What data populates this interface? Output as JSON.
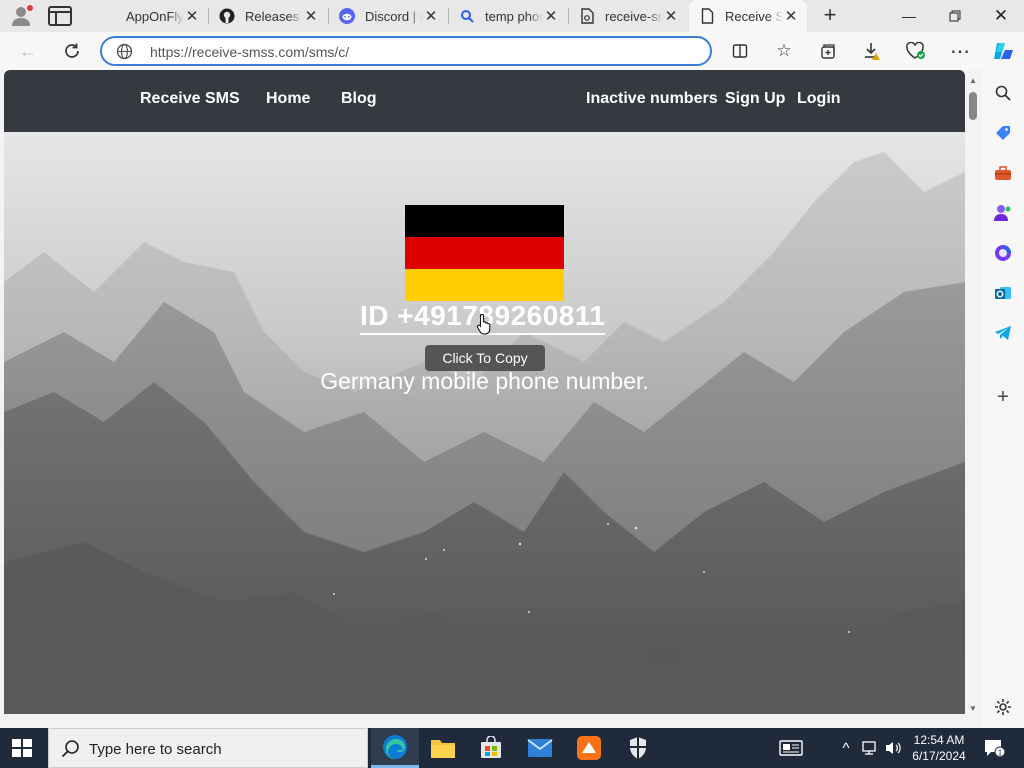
{
  "browser": {
    "tabs": [
      {
        "title": "AppOnFly",
        "favicon": "apponfly-icon"
      },
      {
        "title": "Releases ·",
        "favicon": "github-icon"
      },
      {
        "title": "Discord | #",
        "favicon": "discord-icon"
      },
      {
        "title": "temp phon",
        "favicon": "search-icon"
      },
      {
        "title": "receive-sm",
        "favicon": "document-icon"
      },
      {
        "title": "Receive SM",
        "favicon": "page-icon"
      }
    ],
    "active_tab_index": 5,
    "url": "https://receive-smss.com/sms/c/",
    "accent_color": "#3a7fd5"
  },
  "site": {
    "nav_left": [
      "Receive SMS",
      "Home",
      "Blog"
    ],
    "nav_right": [
      "Inactive numbers",
      "Sign Up",
      "Login"
    ],
    "nav_bg": "#343a40",
    "phone_id": "ID +491789260811",
    "tooltip": "Click To Copy",
    "subtitle": "Germany mobile phone number.",
    "flag_colors": [
      "#000000",
      "#DD0000",
      "#FFCE00"
    ]
  },
  "taskbar": {
    "search_placeholder": "Type here to search",
    "time": "12:54 AM",
    "date": "6/17/2024"
  }
}
